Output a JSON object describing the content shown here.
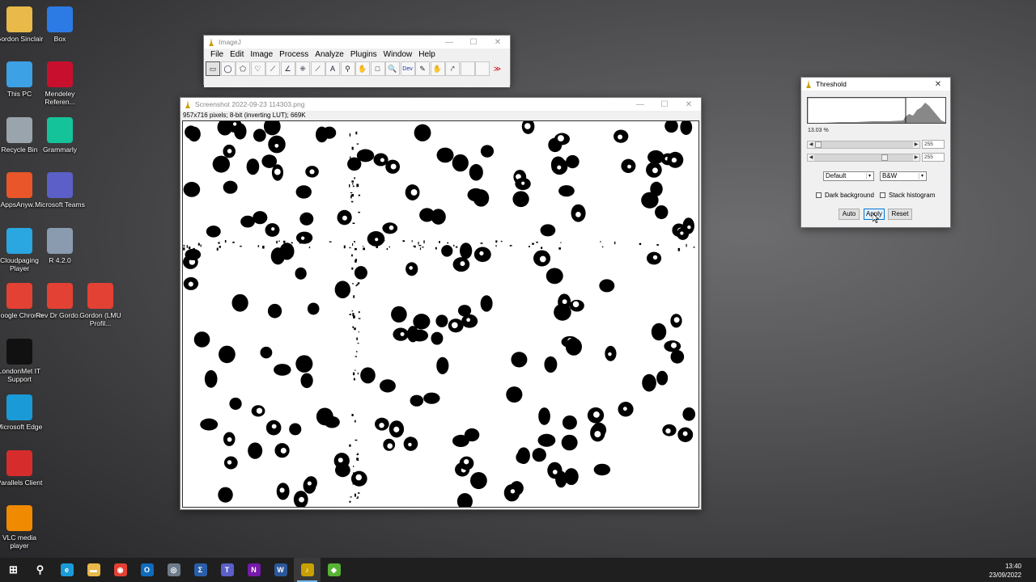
{
  "desktop": {
    "icons": [
      {
        "label": "Gordon Sinclair",
        "icon": "folder-icon",
        "color": "#e9b949"
      },
      {
        "label": "Box",
        "icon": "box-icon",
        "color": "#2c7be5"
      },
      {
        "label": "This PC",
        "icon": "computer-icon",
        "color": "#3da1e6"
      },
      {
        "label": "Mendeley Referen...",
        "icon": "mendeley-icon",
        "color": "#c8102e"
      },
      {
        "label": "Recycle Bin",
        "icon": "recycle-bin-icon",
        "color": "#9aa4ad"
      },
      {
        "label": "Grammarly",
        "icon": "grammarly-icon",
        "color": "#15c39a"
      },
      {
        "label": "AppsAnyw...",
        "icon": "appsanywhere-icon",
        "color": "#e8562a"
      },
      {
        "label": "Microsoft Teams",
        "icon": "teams-icon",
        "color": "#5b5fc7"
      },
      {
        "label": "Cloudpaging Player",
        "icon": "cloudpaging-icon",
        "color": "#2aa6e0"
      },
      {
        "label": "R 4.2.0",
        "icon": "r-icon",
        "color": "#8a9bb0"
      },
      {
        "label": "Google Chrome",
        "icon": "chrome-icon",
        "color": "#e34133"
      },
      {
        "label": "Rev Dr Gordo...",
        "icon": "chrome-profile-icon",
        "color": "#e34133"
      },
      {
        "label": "Gordon (LMU Profil...",
        "icon": "chrome-profile-icon",
        "color": "#e34133"
      },
      {
        "label": "LondonMet IT Support",
        "icon": "londonmet-icon",
        "color": "#111111"
      },
      {
        "label": "Microsoft Edge",
        "icon": "edge-icon",
        "color": "#1a9bd7"
      },
      {
        "label": "Parallels Client",
        "icon": "parallels-icon",
        "color": "#d62c2c"
      },
      {
        "label": "VLC media player",
        "icon": "vlc-icon",
        "color": "#f08a00"
      }
    ]
  },
  "imagej": {
    "title": "ImageJ",
    "menu": [
      "File",
      "Edit",
      "Image",
      "Process",
      "Analyze",
      "Plugins",
      "Window",
      "Help"
    ],
    "tools": [
      {
        "name": "rectangle-tool-icon",
        "glyph": "▭"
      },
      {
        "name": "oval-tool-icon",
        "glyph": "◯"
      },
      {
        "name": "polygon-tool-icon",
        "glyph": "⬠"
      },
      {
        "name": "freehand-tool-icon",
        "glyph": "♡"
      },
      {
        "name": "line-tool-icon",
        "glyph": "⟋"
      },
      {
        "name": "angle-tool-icon",
        "glyph": "∠"
      },
      {
        "name": "multipoint-tool-icon",
        "glyph": "⁜"
      },
      {
        "name": "wand-tool-icon",
        "glyph": "⟋"
      },
      {
        "name": "text-tool-icon",
        "glyph": "A"
      },
      {
        "name": "magnifier-tool-icon",
        "glyph": "⚲"
      },
      {
        "name": "hand-tool-icon",
        "glyph": "✋"
      },
      {
        "name": "dropper-tool-icon",
        "glyph": "□"
      },
      {
        "name": "zoom-tool-icon",
        "glyph": "🔍"
      },
      {
        "name": "dev-tool-icon",
        "glyph": "Dev"
      },
      {
        "name": "pencil-tool-icon",
        "glyph": "✎"
      },
      {
        "name": "brush-tool-icon",
        "glyph": "✋"
      },
      {
        "name": "pipette-tool-icon",
        "glyph": "⤤"
      },
      {
        "name": "blank-tool-icon",
        "glyph": ""
      },
      {
        "name": "blank-tool-icon",
        "glyph": ""
      },
      {
        "name": "more-tools-icon",
        "glyph": "≫"
      }
    ]
  },
  "image_window": {
    "title": "Screenshot 2022-09-23 114303.png",
    "info": "957x716 pixels; 8-bit (inverting LUT); 669K"
  },
  "threshold": {
    "title": "Threshold",
    "percent": "13.03 %",
    "slider1_value": "255",
    "slider2_value": "255",
    "method": "Default",
    "mode": "B&W",
    "dark_background": "Dark background",
    "stack_histogram": "Stack histogram",
    "auto": "Auto",
    "apply": "Apply",
    "reset": "Reset"
  },
  "taskbar": {
    "time": "13:40",
    "date": "23/09/2022",
    "apps": [
      {
        "name": "start-icon",
        "glyph": "⊞",
        "color": "#ffffff"
      },
      {
        "name": "search-icon",
        "glyph": "⚲",
        "color": "#ffffff"
      },
      {
        "name": "edge-icon",
        "glyph": "e",
        "color": "#1a9bd7"
      },
      {
        "name": "file-explorer-icon",
        "glyph": "▬",
        "color": "#e9b949"
      },
      {
        "name": "chrome-icon",
        "glyph": "◉",
        "color": "#e34133"
      },
      {
        "name": "outlook-icon",
        "glyph": "O",
        "color": "#0f6cbd"
      },
      {
        "name": "teamviewer-icon",
        "glyph": "◎",
        "color": "#6e7b8b"
      },
      {
        "name": "sigma-icon",
        "glyph": "Σ",
        "color": "#2a5ea8"
      },
      {
        "name": "teams-icon",
        "glyph": "T",
        "color": "#5b5fc7"
      },
      {
        "name": "onenote-icon",
        "glyph": "N",
        "color": "#7719aa"
      },
      {
        "name": "word-icon",
        "glyph": "W",
        "color": "#2b579a"
      },
      {
        "name": "imagej-icon",
        "glyph": "♪",
        "color": "#c8a000"
      },
      {
        "name": "qgis-icon",
        "glyph": "◆",
        "color": "#58b334"
      }
    ]
  }
}
